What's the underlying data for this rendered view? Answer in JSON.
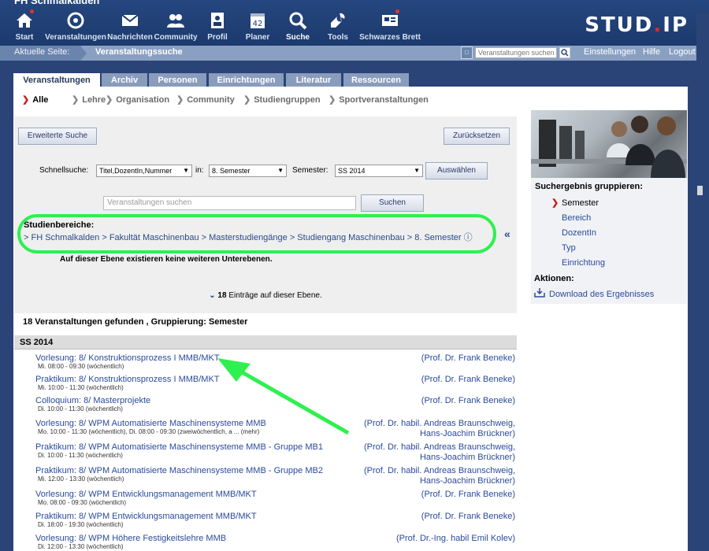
{
  "site_name": "FH Schmalkalden",
  "logo": {
    "main": "STUD",
    "accent": ".",
    "suffix": "IP"
  },
  "nav": [
    {
      "label": "Start",
      "icon": "home-icon"
    },
    {
      "label": "Veranstaltungen",
      "icon": "courses-icon"
    },
    {
      "label": "Nachrichten",
      "icon": "mail-icon"
    },
    {
      "label": "Community",
      "icon": "community-icon"
    },
    {
      "label": "Profil",
      "icon": "profile-icon"
    },
    {
      "label": "Planer",
      "icon": "calendar-icon",
      "badge": "42"
    },
    {
      "label": "Suche",
      "icon": "search-icon"
    },
    {
      "label": "Tools",
      "icon": "wrench-icon"
    },
    {
      "label": "Schwarzes Brett",
      "icon": "board-icon"
    }
  ],
  "locbar": {
    "label": "Aktuelle Seite:",
    "page": "Veranstaltungssuche",
    "search_placeholder": "Veranstaltungen suchen",
    "links": [
      "Einstellungen",
      "Hilfe",
      "Logout"
    ]
  },
  "tabs": [
    "Veranstaltungen",
    "Archiv",
    "Personen",
    "Einrichtungen",
    "Literatur",
    "Ressourcen"
  ],
  "subnav": [
    "Alle",
    "Lehre",
    "Organisation",
    "Community",
    "Studiengruppen",
    "Sportveranstaltungen"
  ],
  "search": {
    "extended_button": "Erweiterte Suche",
    "reset_button": "Zurücksetzen",
    "quick_label": "Schnellsuche:",
    "quick_value": "Titel,DozentIn,Nummer",
    "in_label": "in:",
    "in_value": "8. Semester",
    "semester_label": "Semester:",
    "semester_value": "SS 2014",
    "select_button": "Auswählen",
    "placeholder": "Veranstaltungen suchen",
    "search_button": "Suchen"
  },
  "studien": {
    "heading": "Studienbereiche:",
    "path": "> FH Schmalkalden > Fakultät Maschinenbau > Masterstudiengänge > Studiengang Maschinenbau > 8. Semester",
    "info": "ⓘ",
    "no_levels": "Auf dieser Ebene existieren keine weiteren Unterebenen."
  },
  "entries": {
    "count": "18",
    "text": "Einträge auf dieser Ebene."
  },
  "found": "18 Veranstaltungen gefunden , Gruppierung: Semester",
  "semester_group": "SS 2014",
  "courses": [
    {
      "title": "Vorlesung: 8/ Konstruktionsprozess I MMB/MKT",
      "time": "Mi. 08:00 - 09:30 (wöchentlich)",
      "prof": [
        "(Prof. Dr. Frank Beneke)"
      ]
    },
    {
      "title": "Praktikum: 8/ Konstruktionsprozess I MMB/MKT",
      "time": "Mi. 10:00 - 11:30 (wöchentlich)",
      "prof": [
        "(Prof. Dr. Frank Beneke)"
      ]
    },
    {
      "title": "Colloquium: 8/ Masterprojekte",
      "time": "Di. 10:00 - 11:30 (wöchentlich)",
      "prof": [
        "(Prof. Dr. Frank Beneke)"
      ]
    },
    {
      "title": "Vorlesung: 8/ WPM Automatisierte Maschinensysteme MMB",
      "time": "Mo. 10:00 - 11:30 (wöchentlich), Di. 08:00 - 09:30 (zweiwöchentlich, a ... (mehr)",
      "prof": [
        "(Prof. Dr. habil. Andreas Braunschweig,",
        "Hans-Joachim Brückner)"
      ]
    },
    {
      "title": "Praktikum: 8/ WPM Automatisierte Maschinensysteme MMB - Gruppe MB1",
      "time": "Di. 10:00 - 11:30 (wöchentlich)",
      "prof": [
        "(Prof. Dr. habil. Andreas Braunschweig,",
        "Hans-Joachim Brückner)"
      ]
    },
    {
      "title": "Praktikum: 8/ WPM Automatisierte Maschinensysteme MMB - Gruppe MB2",
      "time": "Mi. 12:00 - 13:30 (wöchentlich)",
      "prof": [
        "(Prof. Dr. habil. Andreas Braunschweig,",
        "Hans-Joachim Brückner)"
      ]
    },
    {
      "title": "Vorlesung: 8/ WPM Entwicklungsmanagement MMB/MKT",
      "time": "Mo. 08:00 - 09:30 (wöchentlich)",
      "prof": [
        "(Prof. Dr. Frank Beneke)"
      ]
    },
    {
      "title": "Praktikum: 8/ WPM Entwicklungsmanagement MMB/MKT",
      "time": "Di. 18:00 - 19:30 (wöchentlich)",
      "prof": [
        "(Prof. Dr. Frank Beneke)"
      ]
    },
    {
      "title": "Vorlesung: 8/ WPM Höhere Festigkeitslehre MMB",
      "time": "Di. 12:00 - 13:30 (wöchentlich)",
      "prof": [
        "(Prof. Dr.-Ing. habil Emil Kolev)"
      ]
    }
  ],
  "sidebar": {
    "group_heading": "Suchergebnis gruppieren:",
    "group_items": [
      "Semester",
      "Bereich",
      "DozentIn",
      "Typ",
      "Einrichtung"
    ],
    "actions_heading": "Aktionen:",
    "download": "Download des Ergebnisses"
  },
  "colors": {
    "header_bg": "#1c3a6d",
    "link": "#2a4a9a",
    "highlight": "#2ef050",
    "accent": "#d9272e"
  }
}
